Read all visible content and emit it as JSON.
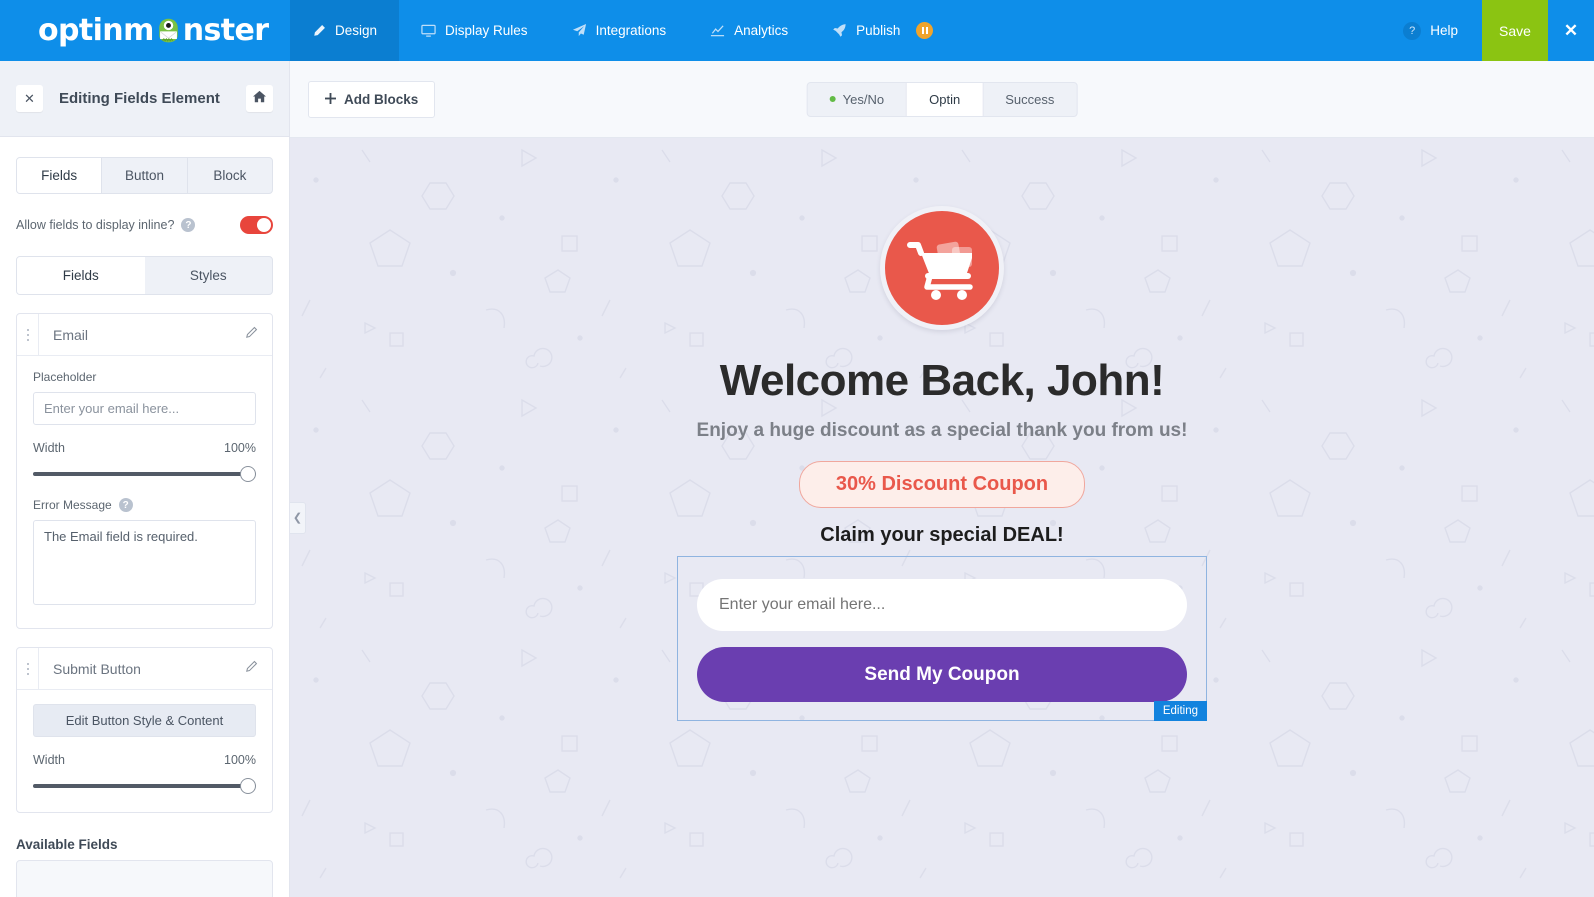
{
  "topbar": {
    "logo_text_left": "optinm",
    "logo_text_right": "nster",
    "logo_icon": "monster-mascot-icon",
    "nav": [
      {
        "label": "Design",
        "icon": "pencil-icon",
        "active": true,
        "badge": null
      },
      {
        "label": "Display Rules",
        "icon": "monitor-icon",
        "active": false,
        "badge": null
      },
      {
        "label": "Integrations",
        "icon": "paper-plane-icon",
        "active": false,
        "badge": null
      },
      {
        "label": "Analytics",
        "icon": "chart-line-icon",
        "active": false,
        "badge": null
      },
      {
        "label": "Publish",
        "icon": "rocket-icon",
        "active": false,
        "badge": "paused"
      }
    ],
    "help_label": "Help",
    "help_icon": "question-mark-icon",
    "save_label": "Save",
    "close_icon": "close-x-icon",
    "colors": {
      "blue": "#0e8ee9",
      "blue_active": "#0b7ed1",
      "green": "#8bc412",
      "badge_orange": "#f0a42b"
    }
  },
  "sidebar": {
    "header": {
      "close_icon": "close-x-icon",
      "title": "Editing Fields Element",
      "home_icon": "home-icon"
    },
    "top_tabs": [
      {
        "label": "Fields",
        "active": true
      },
      {
        "label": "Button",
        "active": false
      },
      {
        "label": "Block",
        "active": false
      }
    ],
    "inline_toggle": {
      "label": "Allow fields to display inline?",
      "help_icon": "question-mark-icon",
      "state": "off",
      "color": "#e8453c"
    },
    "sub_tabs": [
      {
        "label": "Fields",
        "active": true
      },
      {
        "label": "Styles",
        "active": false
      }
    ],
    "cards": [
      {
        "title": "Email",
        "edit_icon": "pencil-icon",
        "drag_icon": "drag-handle-icon",
        "placeholder_label": "Placeholder",
        "placeholder_value": "Enter your email here...",
        "width_label": "Width",
        "width_value": "100%",
        "error_label": "Error Message",
        "error_help_icon": "question-mark-icon",
        "error_value": "The Email field is required."
      },
      {
        "title": "Submit Button",
        "edit_icon": "pencil-icon",
        "drag_icon": "drag-handle-icon",
        "edit_button_label": "Edit Button Style & Content",
        "width_label": "Width",
        "width_value": "100%"
      }
    ],
    "available_fields_label": "Available Fields"
  },
  "canvas": {
    "add_blocks_label": "Add Blocks",
    "add_blocks_icon": "plus-icon",
    "collapse_icon": "chevron-left-icon",
    "view_tabs": [
      {
        "label": "Yes/No",
        "active": false,
        "dot": "#62bb46"
      },
      {
        "label": "Optin",
        "active": true,
        "dot": null
      },
      {
        "label": "Success",
        "active": false,
        "dot": null
      }
    ],
    "background_color": "#e8e9f3"
  },
  "popup": {
    "icon": "shopping-cart-icon",
    "icon_bg_color": "#e9584b",
    "headline": "Welcome Back, John!",
    "subheadline": "Enjoy a huge discount as a special thank you from us!",
    "coupon_badge": "30% Discount Coupon",
    "coupon_color": "#e9584b",
    "claim_text": "Claim your special DEAL!",
    "email_placeholder": "Enter your email here...",
    "submit_label": "Send My Coupon",
    "submit_color": "#6a3eb0",
    "editing_tag": "Editing",
    "editing_tag_color": "#1283de"
  }
}
